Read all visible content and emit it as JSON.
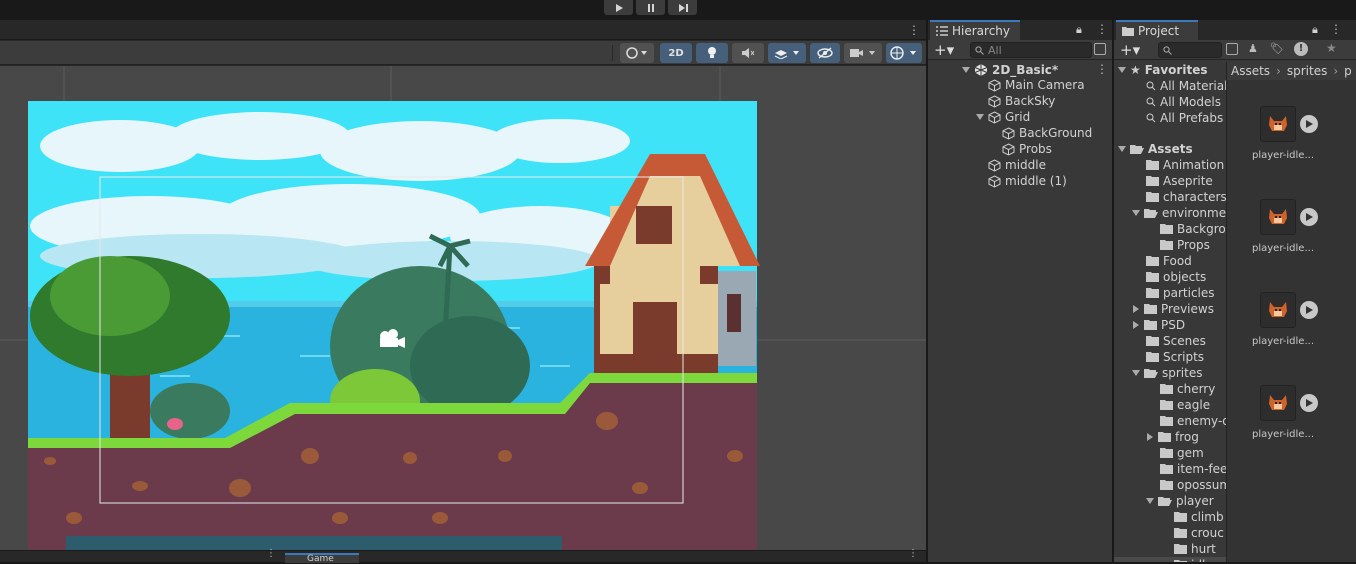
{
  "toolbar": {
    "play_label": "▶",
    "pause_label": "❚❚",
    "step_label": "▶❚"
  },
  "scene": {
    "toggle_2d_label": "2D",
    "game_tab_label": "Game"
  },
  "hierarchy": {
    "tab_label": "Hierarchy",
    "search_placeholder": "All",
    "scene_name": "2D_Basic*",
    "items": [
      {
        "label": "Main Camera"
      },
      {
        "label": "BackSky"
      },
      {
        "label": "Grid"
      },
      {
        "label": "BackGround"
      },
      {
        "label": "Probs"
      },
      {
        "label": "middle"
      },
      {
        "label": "middle (1)"
      }
    ]
  },
  "project": {
    "tab_label": "Project",
    "favorites_label": "Favorites",
    "favorites": [
      "All Material",
      "All Models",
      "All Prefabs"
    ],
    "assets_label": "Assets",
    "folders": [
      "Animation",
      "Aseprite",
      "characters",
      "environmen",
      "Backgro",
      "Props",
      "Food",
      "objects",
      "particles",
      "Previews",
      "PSD",
      "Scenes",
      "Scripts",
      "sprites",
      "cherry",
      "eagle",
      "enemy-d",
      "frog",
      "gem",
      "item-fee",
      "opossum",
      "player",
      "climb",
      "crouc",
      "hurt",
      "idle"
    ],
    "breadcrumb": [
      "Assets",
      "sprites",
      "p"
    ],
    "thumbnails": [
      "player-idle...",
      "player-idle...",
      "player-idle...",
      "player-idle..."
    ]
  },
  "colors": {
    "accent": "#3a79bb",
    "toggle_on": "#46607c",
    "sky": "#3fe3f7",
    "dirt": "#6b3b4c",
    "grass": "#7dd83c"
  }
}
